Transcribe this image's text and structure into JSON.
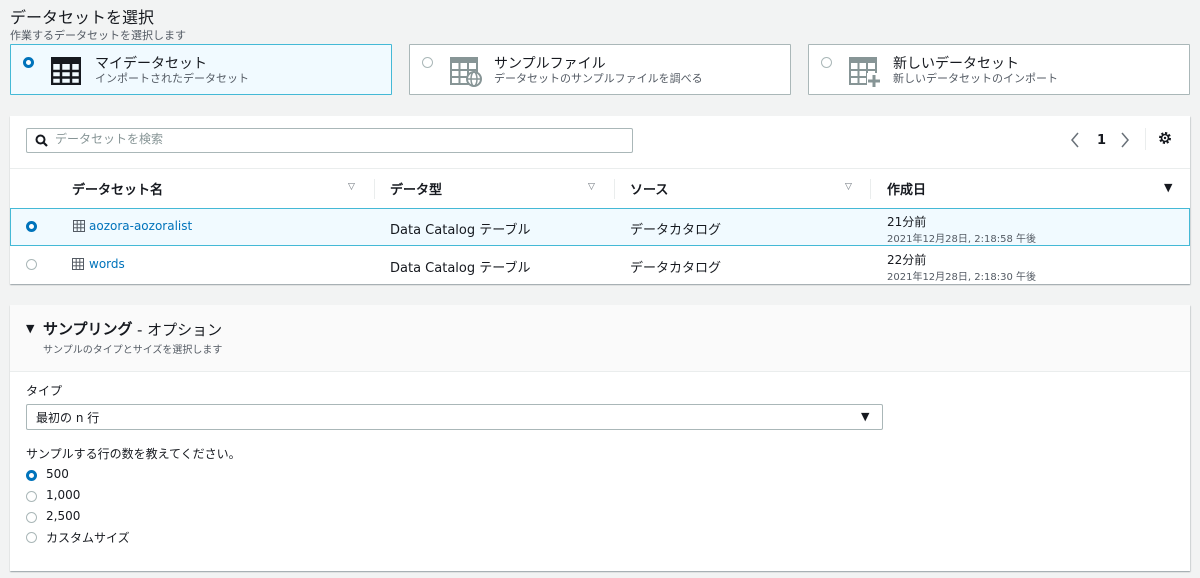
{
  "header": {
    "title": "データセットを選択",
    "subtitle": "作業するデータセットを選択します"
  },
  "source_cards": [
    {
      "title": "マイデータセット",
      "desc": "インポートされたデータセット",
      "selected": true,
      "icon": "table-icon"
    },
    {
      "title": "サンプルファイル",
      "desc": "データセットのサンプルファイルを調べる",
      "selected": false,
      "icon": "table-globe-icon"
    },
    {
      "title": "新しいデータセット",
      "desc": "新しいデータセットのインポート",
      "selected": false,
      "icon": "table-add-icon"
    }
  ],
  "table": {
    "search_placeholder": "データセットを検索",
    "page": "1",
    "columns": [
      "データセット名",
      "データ型",
      "ソース",
      "作成日"
    ],
    "rows": [
      {
        "name": "aozora-aozoralist",
        "type": "Data Catalog テーブル",
        "source": "データカタログ",
        "ago": "21分前",
        "date": "2021年12月28日, 2:18:58 午後",
        "selected": true
      },
      {
        "name": "words",
        "type": "Data Catalog テーブル",
        "source": "データカタログ",
        "ago": "22分前",
        "date": "2021年12月28日, 2:18:30 午後",
        "selected": false
      }
    ]
  },
  "sampling": {
    "title_bold": "サンプリング",
    "title_rest": "- オプション",
    "subtitle": "サンプルのタイプとサイズを選択します",
    "type_label": "タイプ",
    "type_value": "最初の n 行",
    "rows_label": "サンプルする行の数を教えてください。",
    "options": [
      {
        "label": "500",
        "selected": true
      },
      {
        "label": "1,000",
        "selected": false
      },
      {
        "label": "2,500",
        "selected": false
      },
      {
        "label": "カスタムサイズ",
        "selected": false
      }
    ]
  },
  "colors": {
    "accent": "#0073bb",
    "selected_bg": "#f1faff",
    "selected_border": "#44b9d6"
  }
}
